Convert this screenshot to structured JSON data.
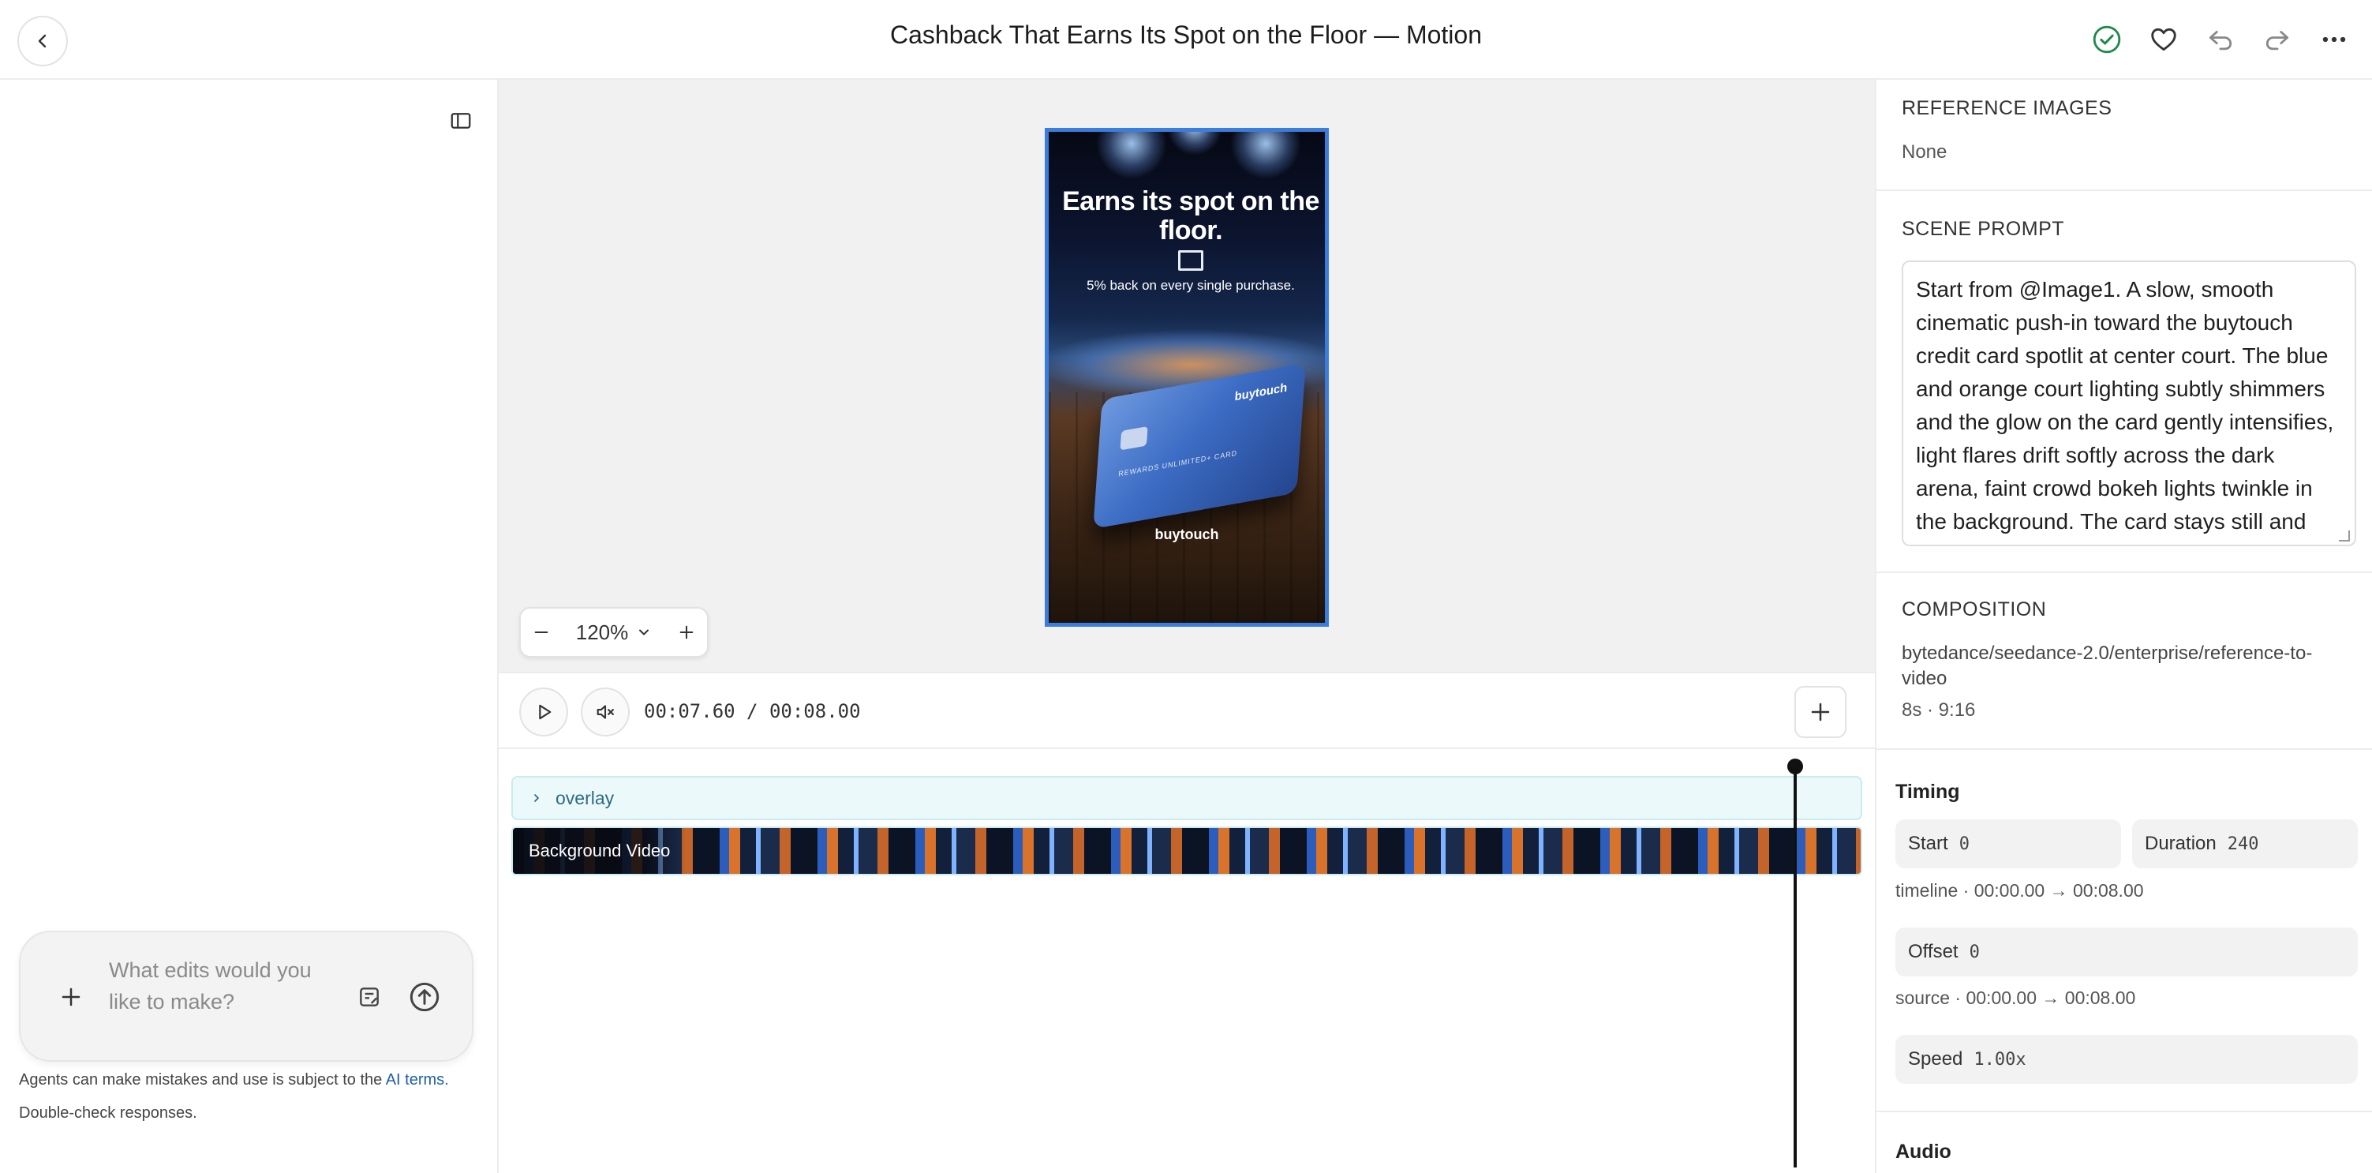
{
  "header": {
    "title": "Cashback That Earns Its Spot on the Floor — Motion"
  },
  "preview": {
    "ad_headline": "Earns its spot on the floor.",
    "ad_subline": "5% back on every single purchase.",
    "card_brand": "buytouch",
    "card_small_text": "REWARDS UNLIMITED+ CARD",
    "ad_logo": "buytouch",
    "zoom_label": "120%"
  },
  "transport": {
    "timecode": "00:07.60 / 00:08.00",
    "current_time": "00:07.60",
    "total_time": "00:08.00"
  },
  "timeline": {
    "tracks": [
      {
        "label": "overlay",
        "collapsed": true
      },
      {
        "label": "Background Video"
      }
    ],
    "playhead_fraction": 0.95
  },
  "chat": {
    "placeholder": "What edits would you like to make?",
    "disclaimer_text": "Agents can make mistakes and use is subject to the",
    "disclaimer_link": "AI terms.",
    "disclaimer_line2": "Double-check responses."
  },
  "inspector": {
    "reference_images": {
      "heading": "REFERENCE IMAGES",
      "value": "None"
    },
    "scene_prompt": {
      "heading": "SCENE PROMPT",
      "text": "Start from @Image1. A slow, smooth cinematic push-in toward the buytouch credit card spotlit at center court. The blue and orange court lighting subtly shimmers and the glow on the card gently intensifies, light flares drift softly across the dark arena, faint crowd bokeh lights twinkle in the background. The card stays still and crisp,"
    },
    "composition": {
      "heading": "COMPOSITION",
      "model": "bytedance/seedance-2.0/enterprise/reference-to-video",
      "meta": "8s · 9:16"
    },
    "timing": {
      "heading": "Timing",
      "start_label": "Start",
      "start_value": "0",
      "duration_label": "Duration",
      "duration_value": "240",
      "timeline_range": "timeline · 00:00.00 → 00:08.00",
      "offset_label": "Offset",
      "offset_value": "0",
      "source_range": "source · 00:00.00 → 00:08.00",
      "speed_label": "Speed",
      "speed_value": "1.00x"
    },
    "audio": {
      "heading": "Audio"
    }
  },
  "colors": {
    "accent_blue": "#3b7ddd",
    "status_green": "#1f8a4c",
    "overlay_track": "#ecf9fb",
    "link": "#1a5fa8"
  },
  "icons": [
    "back-arrow-icon",
    "check-circle-icon",
    "heart-icon",
    "undo-icon",
    "redo-icon",
    "more-icon",
    "sidebar-toggle-icon",
    "play-icon",
    "mute-icon",
    "plus-icon",
    "note-icon",
    "send-icon",
    "chevron-down-icon",
    "chevron-right-icon",
    "minus-icon"
  ]
}
